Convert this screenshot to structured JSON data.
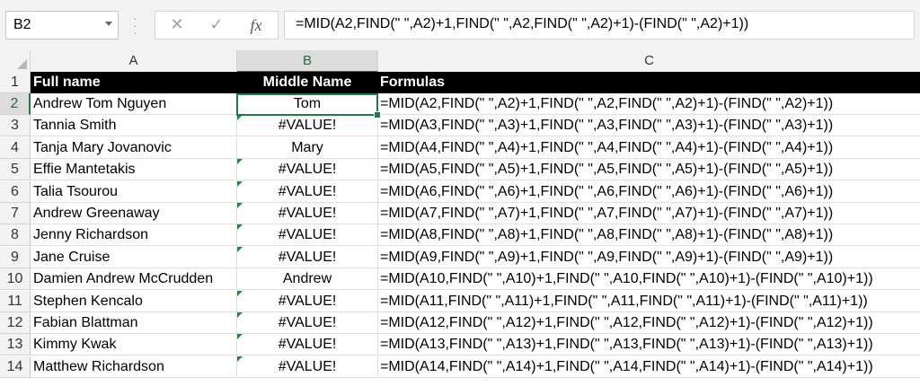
{
  "name_box": "B2",
  "formula": "=MID(A2,FIND(\" \",A2)+1,FIND(\" \",A2,FIND(\" \",A2)+1)-(FIND(\" \",A2)+1))",
  "formula_buttons": {
    "cancel": "✕",
    "enter": "✓",
    "fx": "fx"
  },
  "columns": [
    "A",
    "B",
    "C"
  ],
  "header_row": {
    "row": "1",
    "a": "Full name",
    "b": "Middle Name",
    "c": "Formulas"
  },
  "rows": [
    {
      "row": "2",
      "a": "Andrew Tom Nguyen",
      "b": "Tom",
      "c": "=MID(A2,FIND(\" \",A2)+1,FIND(\" \",A2,FIND(\" \",A2)+1)-(FIND(\" \",A2)+1))"
    },
    {
      "row": "3",
      "a": "Tannia Smith",
      "b": "#VALUE!",
      "c": "=MID(A3,FIND(\" \",A3)+1,FIND(\" \",A3,FIND(\" \",A3)+1)-(FIND(\" \",A3)+1))"
    },
    {
      "row": "4",
      "a": "Tanja Mary Jovanovic",
      "b": "Mary",
      "c": "=MID(A4,FIND(\" \",A4)+1,FIND(\" \",A4,FIND(\" \",A4)+1)-(FIND(\" \",A4)+1))"
    },
    {
      "row": "5",
      "a": "Effie Mantetakis",
      "b": "#VALUE!",
      "c": "=MID(A5,FIND(\" \",A5)+1,FIND(\" \",A5,FIND(\" \",A5)+1)-(FIND(\" \",A5)+1))"
    },
    {
      "row": "6",
      "a": "Talia Tsourou",
      "b": "#VALUE!",
      "c": "=MID(A6,FIND(\" \",A6)+1,FIND(\" \",A6,FIND(\" \",A6)+1)-(FIND(\" \",A6)+1))"
    },
    {
      "row": "7",
      "a": "Andrew Greenaway",
      "b": "#VALUE!",
      "c": "=MID(A7,FIND(\" \",A7)+1,FIND(\" \",A7,FIND(\" \",A7)+1)-(FIND(\" \",A7)+1))"
    },
    {
      "row": "8",
      "a": "Jenny Richardson",
      "b": "#VALUE!",
      "c": "=MID(A8,FIND(\" \",A8)+1,FIND(\" \",A8,FIND(\" \",A8)+1)-(FIND(\" \",A8)+1))"
    },
    {
      "row": "9",
      "a": "Jane Cruise",
      "b": "#VALUE!",
      "c": "=MID(A9,FIND(\" \",A9)+1,FIND(\" \",A9,FIND(\" \",A9)+1)-(FIND(\" \",A9)+1))"
    },
    {
      "row": "10",
      "a": "Damien Andrew McCrudden",
      "b": "Andrew",
      "c": "=MID(A10,FIND(\" \",A10)+1,FIND(\" \",A10,FIND(\" \",A10)+1)-(FIND(\" \",A10)+1))"
    },
    {
      "row": "11",
      "a": "Stephen Kencalo",
      "b": "#VALUE!",
      "c": "=MID(A11,FIND(\" \",A11)+1,FIND(\" \",A11,FIND(\" \",A11)+1)-(FIND(\" \",A11)+1))"
    },
    {
      "row": "12",
      "a": "Fabian Blattman",
      "b": "#VALUE!",
      "c": "=MID(A12,FIND(\" \",A12)+1,FIND(\" \",A12,FIND(\" \",A12)+1)-(FIND(\" \",A12)+1))"
    },
    {
      "row": "13",
      "a": "Kimmy Kwak",
      "b": "#VALUE!",
      "c": "=MID(A13,FIND(\" \",A13)+1,FIND(\" \",A13,FIND(\" \",A13)+1)-(FIND(\" \",A13)+1))"
    },
    {
      "row": "14",
      "a": "Matthew Richardson",
      "b": "#VALUE!",
      "c": "=MID(A14,FIND(\" \",A14)+1,FIND(\" \",A14,FIND(\" \",A14)+1)-(FIND(\" \",A14)+1))"
    }
  ],
  "colors": {
    "selection": "#1f7a46",
    "error_indicator": "#1e8a3a",
    "header_fill": "#000000"
  }
}
